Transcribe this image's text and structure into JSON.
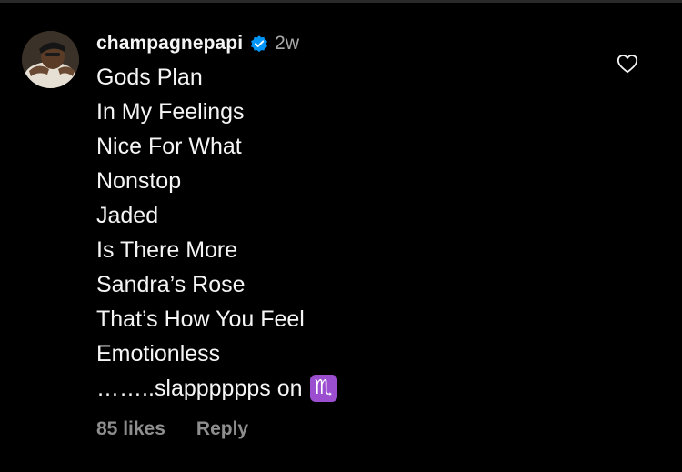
{
  "comment": {
    "username": "champagnepapi",
    "timestamp": "2w",
    "lines": [
      "Gods Plan",
      "In My Feelings",
      "Nice For What",
      "Nonstop",
      "Jaded",
      "Is There More",
      "Sandra’s Rose",
      "That’s How You Feel",
      "Emotionless"
    ],
    "last_line_text": "……..slapppppps on",
    "emoji": "♏",
    "likes": "85 likes",
    "reply_label": "Reply"
  },
  "icons": {
    "verified": "verified-badge-icon",
    "like": "heart-outline-icon",
    "emoji": "scorpio-emoji"
  },
  "colors": {
    "background": "#000000",
    "text": "#f5f5f5",
    "muted": "#a8a8a8",
    "verified_blue": "#0095f6",
    "scorpio_purple": "#9b4ecf"
  }
}
